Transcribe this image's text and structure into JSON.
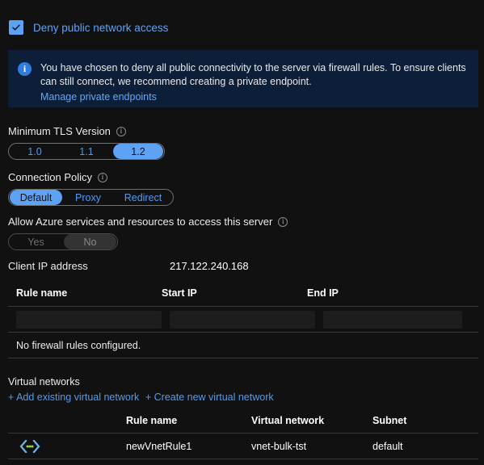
{
  "deny_public_network": {
    "label": "Deny public network access",
    "checked": true,
    "icon": "checkbox-checked-icon",
    "accent_color": "#5da2f5"
  },
  "info_banner": {
    "icon": "info-circle-icon",
    "icon_glyph": "i",
    "text": "You have chosen to deny all public connectivity to the server via firewall rules. To ensure clients can still connect, we recommend creating a private endpoint.",
    "link_label": "Manage private endpoints",
    "background_color": "#0d1f38",
    "link_color": "#62a8f7"
  },
  "min_tls_version": {
    "label": "Minimum TLS Version",
    "info_icon": "info-icon",
    "options": [
      "1.0",
      "1.1",
      "1.2"
    ],
    "selected": "1.2"
  },
  "connection_policy": {
    "label": "Connection Policy",
    "info_icon": "info-icon",
    "options": [
      "Default",
      "Proxy",
      "Redirect"
    ],
    "selected": "Default"
  },
  "allow_azure_services": {
    "label": "Allow Azure services and resources to access this server",
    "info_icon": "info-icon",
    "options": [
      "Yes",
      "No"
    ],
    "selected": "No",
    "disabled": true
  },
  "client_ip": {
    "label": "Client IP address",
    "value": "217.122.240.168"
  },
  "firewall_rules": {
    "columns": [
      "Rule name",
      "Start IP",
      "End IP"
    ],
    "new_rule_inputs": {
      "rule_name": "",
      "start_ip": "",
      "end_ip": ""
    },
    "empty_message": "No firewall rules configured."
  },
  "virtual_networks": {
    "title": "Virtual networks",
    "add_existing_label": "+ Add existing virtual network",
    "create_new_label": "+ Create new virtual network",
    "columns": [
      "Rule name",
      "Virtual network",
      "Subnet"
    ],
    "rows": [
      {
        "icon": "virtual-network-icon",
        "rule_name": "newVnetRule1",
        "virtual_network": "vnet-bulk-tst",
        "subnet": "default"
      }
    ]
  }
}
